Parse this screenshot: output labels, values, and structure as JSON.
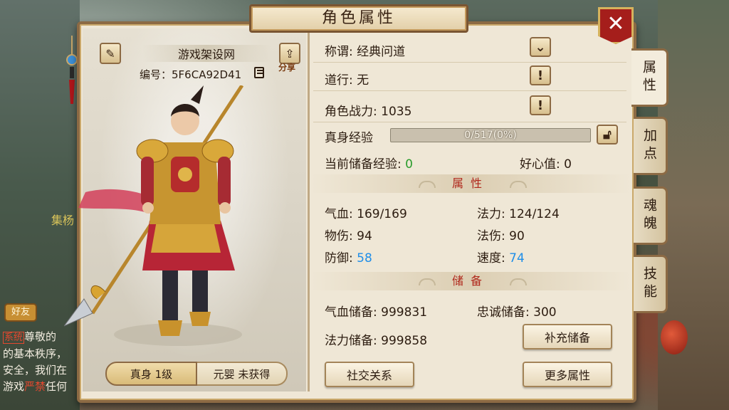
{
  "window": {
    "title": "角色属性"
  },
  "close_label": "✕",
  "character": {
    "name": "游戏架设网",
    "id_text": "编号：5F6CA92D41",
    "share_label": "分享",
    "forms": [
      {
        "label": "真身 1级",
        "active": true
      },
      {
        "label": "元婴 未获得",
        "active": false
      }
    ]
  },
  "info": {
    "title_label": "称谓: 经典问道",
    "daoxing_label": "道行: 无",
    "power_label": "角色战力: 1035",
    "exp_label": "真身经验",
    "exp_text": "0/517(0%)",
    "exp_fraction": 0.0,
    "stored_exp_label": "当前储备经验: ",
    "stored_exp_value": "0",
    "kindness_label": "好心值: 0"
  },
  "attributes": {
    "header": "属性",
    "hp": "气血: 169/169",
    "mp": "法力: 124/124",
    "phys_dmg": "物伤: 94",
    "mag_dmg": "法伤: 90",
    "defense_label": "防御: ",
    "defense_value": "58",
    "speed_label": "速度: ",
    "speed_value": "74"
  },
  "reserves": {
    "header": "储备",
    "hp_reserve": "气血储备: 999831",
    "loyalty_reserve": "忠诚储备: 300",
    "mp_reserve": "法力储备: 999858",
    "refill_button": "补充储备"
  },
  "buttons": {
    "social": "社交关系",
    "more": "更多属性"
  },
  "side_tabs": [
    {
      "label": "属性",
      "active": true
    },
    {
      "label": "加点",
      "active": false
    },
    {
      "label": "魂魄",
      "active": false
    },
    {
      "label": "技能",
      "active": false
    }
  ],
  "background": {
    "collect_text": "集杨",
    "friend_badge": "好友",
    "chat_sys_tag": "系统",
    "chat_line1": "尊敬的",
    "chat_line2": "的基本秩序，",
    "chat_line3": "安全，我们在",
    "chat_line4_a": "游戏",
    "chat_line4_b": "严禁",
    "chat_line4_c": "任何"
  }
}
